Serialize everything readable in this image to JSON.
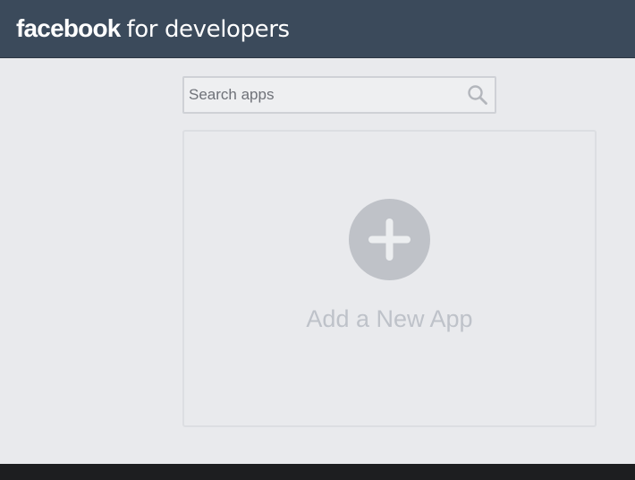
{
  "header": {
    "brand_word": "facebook",
    "brand_tail": "for developers"
  },
  "search": {
    "placeholder": "Search apps",
    "value": "",
    "icon": "search-icon"
  },
  "add_app_card": {
    "label": "Add a New App",
    "icon": "plus-circle-icon"
  },
  "colors": {
    "header_bg": "#3b4a5b",
    "page_bg": "#e9eaed",
    "footer_bg": "#1d1e20",
    "muted_gray": "#bfc2c8"
  }
}
